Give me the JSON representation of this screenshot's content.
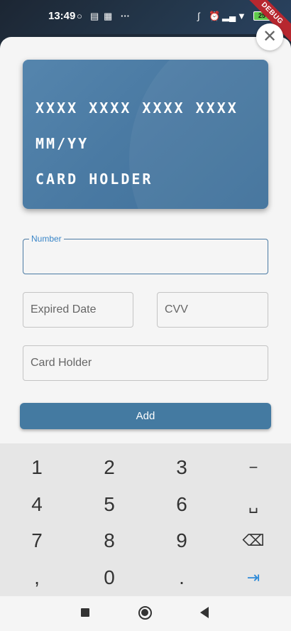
{
  "status_bar": {
    "time": "13:49",
    "battery": "25",
    "debug_banner": "DEBUG",
    "left_icons": [
      "messenger-icon",
      "message-icon",
      "keyboard-icon",
      "more-icon"
    ],
    "right_icons": [
      "bluetooth-icon",
      "alarm-icon",
      "signal-icon",
      "wifi-icon",
      "battery-icon"
    ]
  },
  "card_preview": {
    "number": "XXXX XXXX XXXX XXXX",
    "expiry": "MM/YY",
    "holder": "CARD HOLDER"
  },
  "form": {
    "number_label": "Number",
    "number_value": "",
    "expiry_placeholder": "Expired Date",
    "cvv_placeholder": "CVV",
    "holder_placeholder": "Card Holder",
    "add_label": "Add"
  },
  "keyboard": {
    "rows": [
      [
        "1",
        "2",
        "3",
        "−"
      ],
      [
        "4",
        "5",
        "6",
        "␣"
      ],
      [
        "7",
        "8",
        "9",
        "⌫"
      ],
      [
        ",",
        "0",
        ".",
        "⇥"
      ]
    ]
  },
  "colors": {
    "accent": "#447aa1",
    "focus_label": "#3a86c8",
    "debug": "#b7272f"
  }
}
